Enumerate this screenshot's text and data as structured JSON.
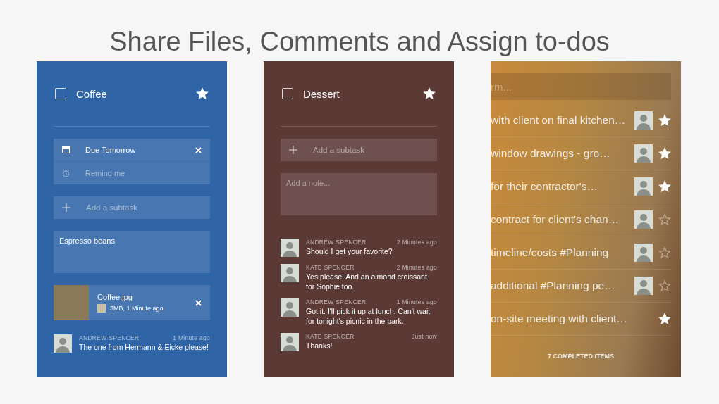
{
  "heading": "Share Files, Comments and Assign to-dos",
  "panels": [
    {
      "kind": "task",
      "title": "Coffee",
      "checked": false,
      "starred": true,
      "due": {
        "label": "Due Tomorrow"
      },
      "reminder": {
        "placeholder": "Remind me"
      },
      "subtask": {
        "placeholder": "Add a subtask"
      },
      "note": {
        "value": "Espresso beans"
      },
      "attachment": {
        "name": "Coffee.jpg",
        "meta": "3MB, 1 Minute ago"
      },
      "comments": [
        {
          "author": "ANDREW SPENCER",
          "time": "1 Minute ago",
          "text": "The one from Hermann & Eicke please!"
        }
      ]
    },
    {
      "kind": "task",
      "title": "Dessert",
      "checked": false,
      "starred": true,
      "subtask": {
        "placeholder": "Add a subtask"
      },
      "note": {
        "placeholder": "Add a note..."
      },
      "comments": [
        {
          "author": "ANDREW SPENCER",
          "time": "2 Minutes ago",
          "text": "Should I get your favorite?"
        },
        {
          "author": "KATE SPENCER",
          "time": "2 Minutes ago",
          "text": "Yes please! And an almond croissant for Sophie too."
        },
        {
          "author": "ANDREW SPENCER",
          "time": "1 Minutes ago",
          "text": "Got it. I'll pick it up at lunch. Can't wait for tonight's picnic in the park."
        },
        {
          "author": "KATE SPENCER",
          "time": "Just now",
          "text": "Thanks!"
        }
      ]
    },
    {
      "kind": "list",
      "search": {
        "placeholder": "rm..."
      },
      "items": [
        {
          "text": "with client on final kitchen…",
          "has_avatar": true,
          "starred": true
        },
        {
          "text": "window drawings - gro…",
          "has_avatar": true,
          "starred": true
        },
        {
          "text": "for their contractor's…",
          "has_avatar": true,
          "starred": true
        },
        {
          "text": "contract for client's chan…",
          "has_avatar": true,
          "starred": false
        },
        {
          "text": "timeline/costs #Planning",
          "has_avatar": true,
          "starred": false
        },
        {
          "text": "additional #Planning pe…",
          "has_avatar": true,
          "starred": false
        },
        {
          "text": "on-site meeting with client…",
          "has_avatar": false,
          "starred": true
        }
      ],
      "footer": "7 COMPLETED ITEMS"
    }
  ]
}
